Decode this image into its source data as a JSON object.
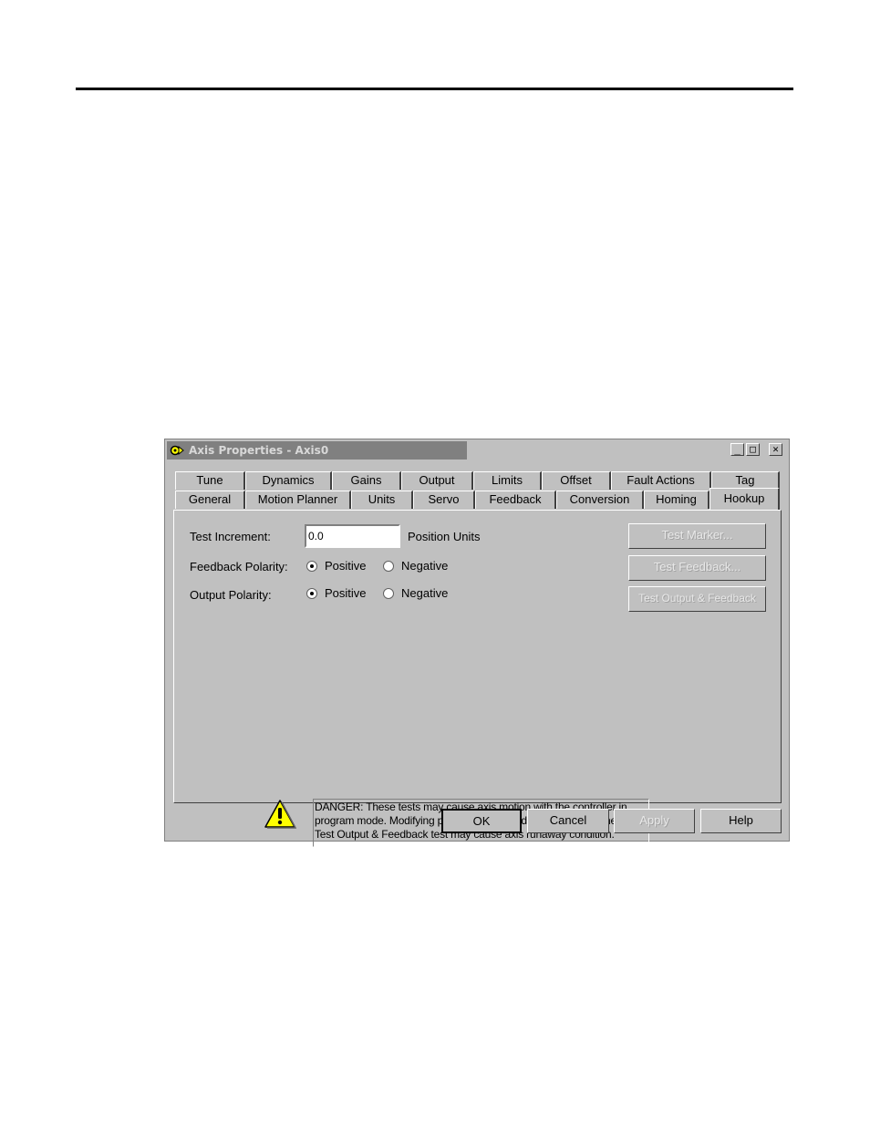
{
  "dialog": {
    "title": "Axis Properties - Axis0",
    "controls": {
      "minimize": "_",
      "maximize": "□",
      "close": "✕"
    },
    "tabs_back": [
      "Tune",
      "Dynamics",
      "Gains",
      "Output",
      "Limits",
      "Offset",
      "Fault Actions",
      "Tag"
    ],
    "tabs_front": [
      "General",
      "Motion Planner",
      "Units",
      "Servo",
      "Feedback",
      "Conversion",
      "Homing",
      "Hookup"
    ],
    "active_tab": "Hookup",
    "test_increment": {
      "label": "Test Increment:",
      "value": "0.0",
      "units": "Position Units"
    },
    "feedback_polarity": {
      "label": "Feedback Polarity:",
      "options": [
        "Positive",
        "Negative"
      ],
      "selected": "Positive"
    },
    "output_polarity": {
      "label": "Output Polarity:",
      "options": [
        "Positive",
        "Negative"
      ],
      "selected": "Positive"
    },
    "side_buttons": [
      "Test Marker...",
      "Test Feedback...",
      "Test Output & Feedback"
    ],
    "warning": {
      "icon": "warning-icon",
      "lines": [
        "DANGER: These tests may cause axis motion with the controller in",
        "program mode. Modifying polarity determined after executing the",
        "Test Output & Feedback test may cause axis runaway condition."
      ]
    },
    "footer_buttons": {
      "ok": "OK",
      "cancel": "Cancel",
      "apply": "Apply",
      "help": "Help"
    }
  }
}
